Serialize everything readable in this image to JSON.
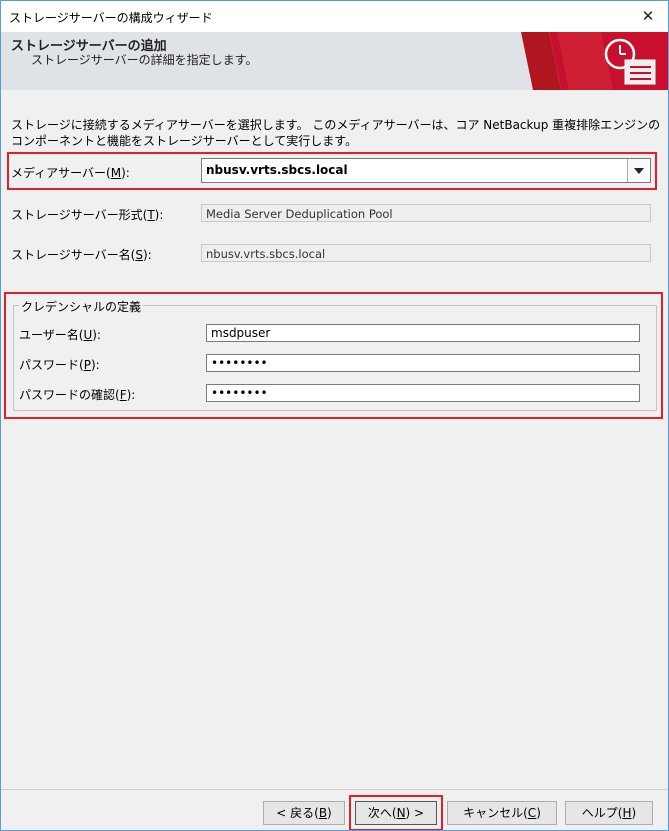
{
  "window": {
    "title": "ストレージサーバーの構成ウィザード"
  },
  "banner": {
    "heading": "ストレージサーバーの追加",
    "subheading": "ストレージサーバーの詳細を指定します。"
  },
  "description": "ストレージに接続するメディアサーバーを選択します。 このメディアサーバーは、コア NetBackup 重複排除エンジンのコンポーネントと機能をストレージサーバーとして実行します。",
  "media_server": {
    "label": "メディアサーバー(",
    "accel": "M",
    "suffix": "):",
    "value": "nbusv.vrts.sbcs.local"
  },
  "server_type": {
    "label": "ストレージサーバー形式(",
    "accel": "T",
    "suffix": "):",
    "value": "Media Server Deduplication Pool"
  },
  "server_name": {
    "label": "ストレージサーバー名(",
    "accel": "S",
    "suffix": "):",
    "value": "nbusv.vrts.sbcs.local"
  },
  "credentials": {
    "title": "クレデンシャルの定義",
    "username": {
      "label": "ユーザー名(",
      "accel": "U",
      "suffix": "):",
      "value": "msdpuser"
    },
    "password": {
      "label": "パスワード(",
      "accel": "P",
      "suffix": "):",
      "value": "••••••••"
    },
    "confirm": {
      "label": "パスワードの確認(",
      "accel": "F",
      "suffix": "):",
      "value": "••••••••"
    }
  },
  "buttons": {
    "back": {
      "label": "< 戻る(",
      "accel": "B",
      "suffix": ")"
    },
    "next": {
      "label": "次へ(",
      "accel": "N",
      "suffix": ") >"
    },
    "cancel": {
      "label": "キャンセル(",
      "accel": "C",
      "suffix": ")"
    },
    "help": {
      "label": "ヘルプ(",
      "accel": "H",
      "suffix": ")"
    }
  },
  "colors": {
    "highlight": "#e0202a",
    "banner_red": "#c8102e",
    "window_border": "#5b9bd5"
  },
  "icons": {
    "close": "close-icon",
    "banner": "netbackup-storage-icon"
  }
}
